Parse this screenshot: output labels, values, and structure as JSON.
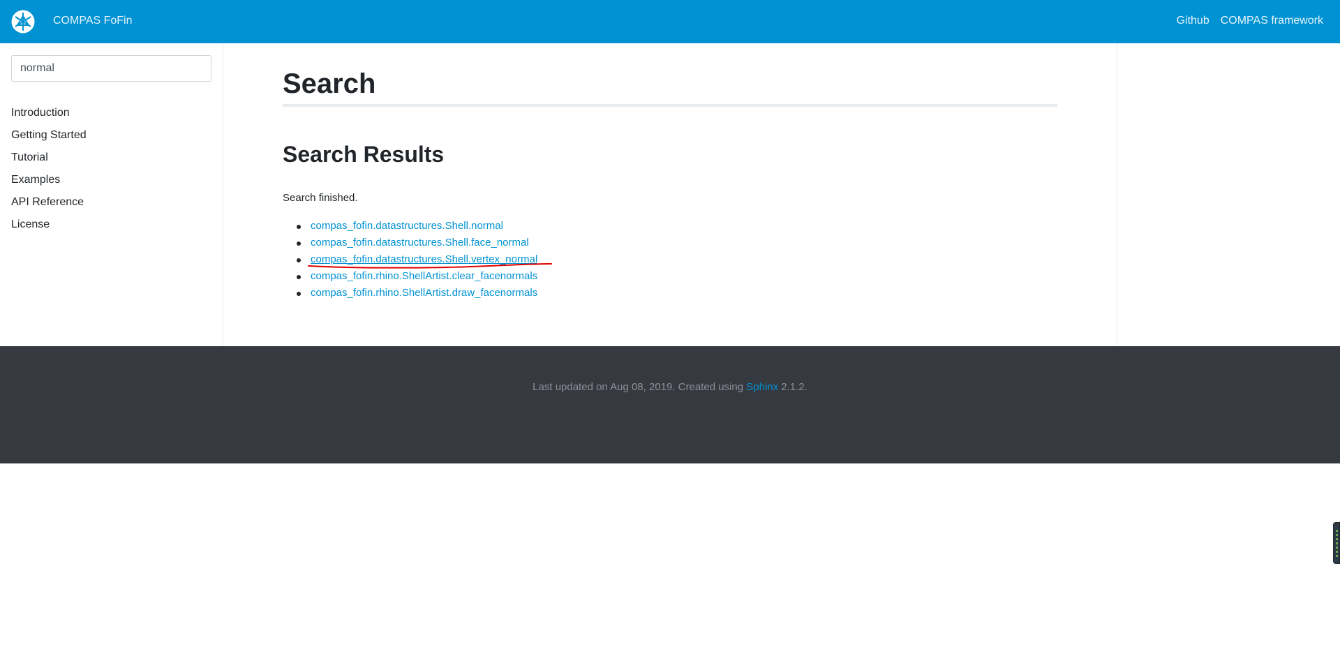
{
  "navbar": {
    "brand": "COMPAS FoFin",
    "links": [
      "Github",
      "COMPAS framework"
    ]
  },
  "sidebar": {
    "search_value": "normal",
    "items": [
      "Introduction",
      "Getting Started",
      "Tutorial",
      "Examples",
      "API Reference",
      "License"
    ]
  },
  "main": {
    "title": "Search",
    "results_heading": "Search Results",
    "status": "Search finished.",
    "results": [
      "compas_fofin.datastructures.Shell.normal",
      "compas_fofin.datastructures.Shell.face_normal",
      "compas_fofin.datastructures.Shell.vertex_normal",
      "compas_fofin.rhino.ShellArtist.clear_facenormals",
      "compas_fofin.rhino.ShellArtist.draw_facenormals"
    ]
  },
  "footer": {
    "prefix": "Last updated on Aug 08, 2019. Created using ",
    "link": "Sphinx",
    "suffix": " 2.1.2."
  },
  "colors": {
    "navbar": "#0092d2",
    "link": "#0092d2",
    "footer": "#363940",
    "annotation": "#e00000"
  }
}
